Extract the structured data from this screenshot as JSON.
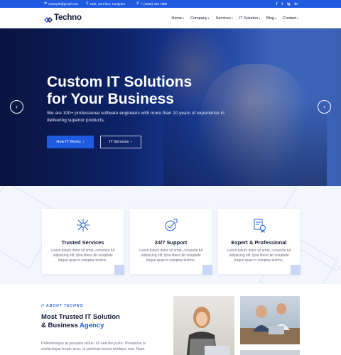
{
  "topbar": {
    "email": "example@gmail.com",
    "address": "24/5, 1st Floor, Kurigram",
    "phone": "+ (1800) 456 7890",
    "socials": [
      "f",
      "t",
      "ig",
      "in"
    ]
  },
  "header": {
    "logo_text": "Techno",
    "nav": [
      {
        "label": "Home",
        "has_dropdown": true
      },
      {
        "label": "Company",
        "has_dropdown": true
      },
      {
        "label": "Services",
        "has_dropdown": true
      },
      {
        "label": "IT Solution",
        "has_dropdown": true
      },
      {
        "label": "Blog",
        "has_dropdown": true
      },
      {
        "label": "Contact",
        "has_dropdown": true
      }
    ]
  },
  "hero": {
    "title_line1": "Custom IT Solutions",
    "title_line2": "for Your Business",
    "description": "We are 100+ professional software engineers with more than 10 years of experience in delivering superior products.",
    "primary_button": "How IT Works",
    "secondary_button": "IT Services"
  },
  "features": [
    {
      "icon": "network-hub-icon",
      "title": "Trusted Services",
      "text": "Lorem ipsum dolor sit amet, consecte tur adipiscing elit. Ipsa libero ab voluptate itaque quas in voluptas techno."
    },
    {
      "icon": "24-7-support-icon",
      "title": "24/7 Support",
      "text": "Lorem ipsum dolor sit amet, consecte tur adipiscing elit. Ipsa libero ab voluptate itaque quas in voluptas techno."
    },
    {
      "icon": "expert-certificate-icon",
      "title": "Expert & Professional",
      "text": "Lorem ipsum dolor sit amet, consecte tur adipiscing elit. Ipsa libero ab voluptate itaque quas in voluptas techno."
    }
  ],
  "about": {
    "label": "// ABOUT TECHNO",
    "title_line1": "Most Trusted IT Solution",
    "title_line2_prefix": "& Business ",
    "title_line2_accent": "Agency",
    "text": "Pellentesque at posuere tellus. Ut sed dui justo. Phasellus is scelerisque turpis arcu, ut pulvinar lectus tristique non. Nam"
  },
  "colors": {
    "brand": "#1f5be0",
    "heading": "#14183a",
    "body_text": "#6b6f86"
  }
}
